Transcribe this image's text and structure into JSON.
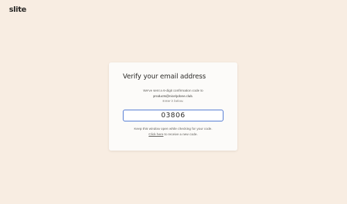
{
  "app": {
    "logo_text": "slite"
  },
  "verify": {
    "title": "Verify your email address",
    "sent_line": "We've sent a 6-digit confirmation code to",
    "email": "products@nicelydone.club.",
    "enter_line": "Enter it below.",
    "code_value": "03806",
    "keep_line": "Keep this window open while checking for your code.",
    "click_here_label": "Click here",
    "resend_suffix": " to receive a new code."
  },
  "colors": {
    "background": "#f8ede2",
    "card": "#fcfbf9",
    "input_border_focus": "#4a74d1"
  }
}
